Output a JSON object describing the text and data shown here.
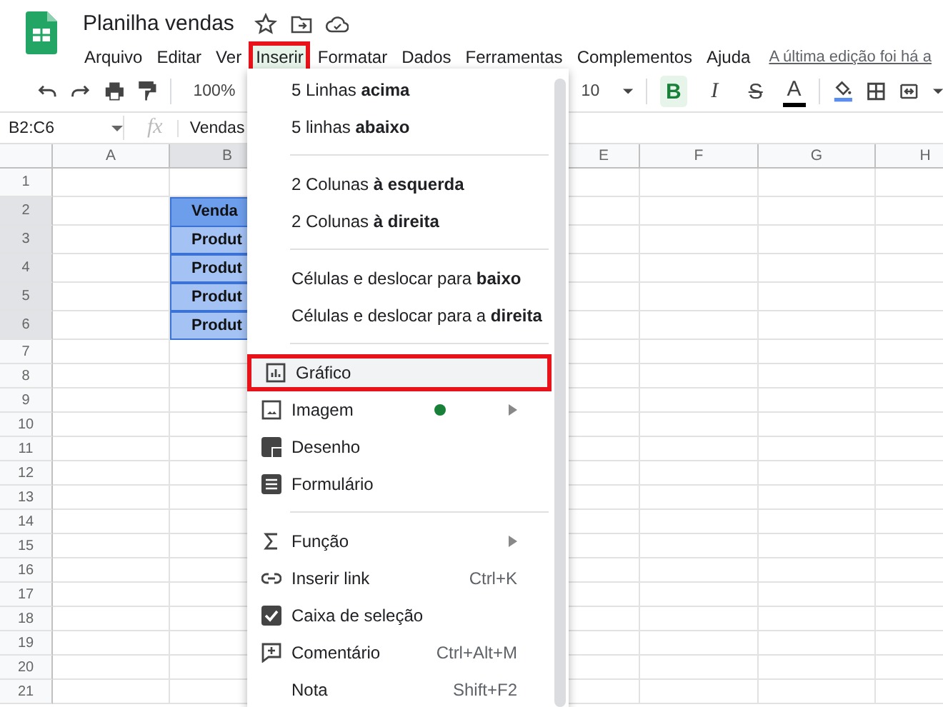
{
  "document": {
    "title": "Planilha vendas",
    "last_edit": "A última edição foi há a"
  },
  "menubar": [
    {
      "label": "Arquivo",
      "selected": false,
      "annotated": false
    },
    {
      "label": "Editar",
      "selected": false,
      "annotated": false
    },
    {
      "label": "Ver",
      "selected": false,
      "annotated": false
    },
    {
      "label": "Inserir",
      "selected": true,
      "annotated": true
    },
    {
      "label": "Formatar",
      "selected": false,
      "annotated": false
    },
    {
      "label": "Dados",
      "selected": false,
      "annotated": false
    },
    {
      "label": "Ferramentas",
      "selected": false,
      "annotated": false
    },
    {
      "label": "Complementos",
      "selected": false,
      "annotated": false
    },
    {
      "label": "Ajuda",
      "selected": false,
      "annotated": false
    }
  ],
  "toolbar": {
    "zoom": "100%",
    "font_size": "10",
    "format_buttons": [
      {
        "label": "B",
        "selected": true
      },
      {
        "label": "I",
        "selected": false
      },
      {
        "label": "S",
        "selected": false
      },
      {
        "label": "A",
        "selected": false
      }
    ]
  },
  "formula_bar": {
    "range": "B2:C6",
    "fx": "fx",
    "value": "Vendas"
  },
  "grid": {
    "columns": [
      {
        "label": "A",
        "selected": false
      },
      {
        "label": "B",
        "selected": true
      },
      {
        "label": "E",
        "selected": false
      },
      {
        "label": "F",
        "selected": false
      },
      {
        "label": "G",
        "selected": false
      },
      {
        "label": "H",
        "selected": false
      }
    ],
    "rows": [
      {
        "number": "1",
        "selected": false
      },
      {
        "number": "2",
        "selected": true,
        "cell_b": {
          "text": "Venda",
          "kind": "header"
        }
      },
      {
        "number": "3",
        "selected": true,
        "cell_b": {
          "text": "Produt",
          "kind": "item"
        }
      },
      {
        "number": "4",
        "selected": true,
        "cell_b": {
          "text": "Produt",
          "kind": "item"
        }
      },
      {
        "number": "5",
        "selected": true,
        "cell_b": {
          "text": "Produt",
          "kind": "item"
        }
      },
      {
        "number": "6",
        "selected": true,
        "cell_b": {
          "text": "Produt",
          "kind": "item"
        }
      },
      {
        "number": "7",
        "selected": false
      },
      {
        "number": "8",
        "selected": false
      },
      {
        "number": "9",
        "selected": false
      },
      {
        "number": "10",
        "selected": false
      },
      {
        "number": "11",
        "selected": false
      },
      {
        "number": "12",
        "selected": false
      },
      {
        "number": "13",
        "selected": false
      },
      {
        "number": "14",
        "selected": false
      },
      {
        "number": "15",
        "selected": false
      },
      {
        "number": "16",
        "selected": false
      },
      {
        "number": "17",
        "selected": false
      },
      {
        "number": "18",
        "selected": false
      },
      {
        "number": "19",
        "selected": false
      },
      {
        "number": "20",
        "selected": false
      },
      {
        "number": "21",
        "selected": false
      }
    ]
  },
  "insert_menu": {
    "sections": [
      [
        {
          "label": "5 Linhas **acima**",
          "highlighted": false,
          "annotated": false
        },
        {
          "label": "5 linhas **abaixo**",
          "highlighted": false,
          "annotated": false
        }
      ],
      [
        {
          "label": "2 Colunas **à esquerda**",
          "highlighted": false,
          "annotated": false
        },
        {
          "label": "2 Colunas **à direita**",
          "highlighted": false,
          "annotated": false
        }
      ],
      [
        {
          "label": "Células e deslocar para **baixo**",
          "highlighted": false,
          "annotated": false
        },
        {
          "label": "Células e deslocar para a **direita**",
          "highlighted": false,
          "annotated": false
        }
      ],
      [
        {
          "label": "Gráfico",
          "highlighted": true,
          "annotated": true
        },
        {
          "label": "Imagem",
          "highlighted": false,
          "annotated": false,
          "new": true,
          "submenu": true
        },
        {
          "label": "Desenho",
          "highlighted": false,
          "annotated": false
        },
        {
          "label": "Formulário",
          "highlighted": false,
          "annotated": false
        }
      ],
      [
        {
          "label": "Função",
          "highlighted": false,
          "annotated": false,
          "submenu": true
        },
        {
          "label": "Inserir link",
          "highlighted": false,
          "annotated": false,
          "shortcut": "Ctrl+K"
        },
        {
          "label": "Caixa de seleção",
          "highlighted": false,
          "annotated": false
        },
        {
          "label": "Comentário",
          "highlighted": false,
          "annotated": false,
          "shortcut": "Ctrl+Alt+M"
        },
        {
          "label": "Nota",
          "highlighted": false,
          "annotated": false,
          "shortcut": "Shift+F2"
        }
      ]
    ]
  }
}
